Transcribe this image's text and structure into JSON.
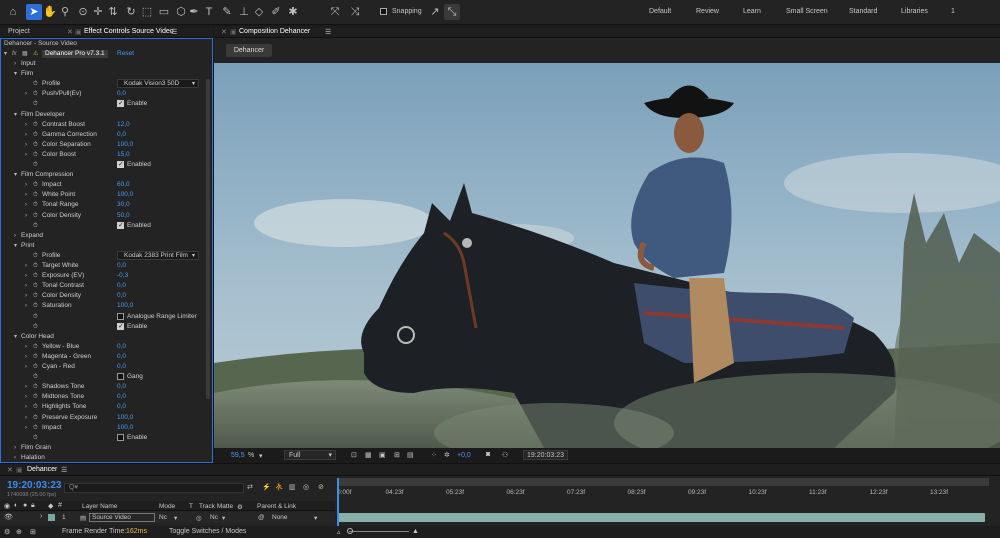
{
  "toolbar": {
    "snapping_label": "Snapping",
    "workspaces": [
      "Default",
      "Review",
      "Learn",
      "Small Screen",
      "Standard",
      "Libraries"
    ],
    "overflow": "1"
  },
  "left_panel": {
    "tabs": {
      "project": "Project",
      "effect_controls": "Effect Controls Source Video"
    },
    "layer_title": "Dehancer - Source Video",
    "effect_name": "Dehancer Pro v7.3.1",
    "reset_label": "Reset",
    "params": [
      {
        "type": "group",
        "label": "Input",
        "open": false
      },
      {
        "type": "group",
        "label": "Film",
        "open": true
      },
      {
        "type": "dropdown",
        "label": "Profile",
        "value": "Kodak Vision3 50D"
      },
      {
        "type": "value",
        "label": "Push/Pull(Ev)",
        "value": "0,0",
        "twirl": true
      },
      {
        "type": "check",
        "checked": true,
        "text": "Enable"
      },
      {
        "type": "group",
        "label": "Film Developer",
        "open": true
      },
      {
        "type": "value",
        "label": "Contrast Boost",
        "value": "12,0",
        "twirl": true
      },
      {
        "type": "value",
        "label": "Gamma Correction",
        "value": "0,0",
        "twirl": true
      },
      {
        "type": "value",
        "label": "Color Separation",
        "value": "100,0",
        "twirl": true
      },
      {
        "type": "value",
        "label": "Color Boost",
        "value": "15,0",
        "twirl": true
      },
      {
        "type": "check",
        "checked": true,
        "text": "Enabled"
      },
      {
        "type": "group",
        "label": "Film Compression",
        "open": true
      },
      {
        "type": "value",
        "label": "Impact",
        "value": "60,0",
        "twirl": true
      },
      {
        "type": "value",
        "label": "White Point",
        "value": "100,0",
        "twirl": true
      },
      {
        "type": "value",
        "label": "Tonal Range",
        "value": "30,0",
        "twirl": true
      },
      {
        "type": "value",
        "label": "Color Density",
        "value": "50,0",
        "twirl": true
      },
      {
        "type": "check",
        "checked": true,
        "text": "Enabled"
      },
      {
        "type": "group",
        "label": "Expand",
        "open": false
      },
      {
        "type": "group",
        "label": "Print",
        "open": true
      },
      {
        "type": "dropdown",
        "label": "Profile",
        "value": "Kodak 2383 Print Film"
      },
      {
        "type": "value",
        "label": "Target White",
        "value": "0,0",
        "twirl": true
      },
      {
        "type": "value",
        "label": "Exposure (EV)",
        "value": "-0,3",
        "twirl": true
      },
      {
        "type": "value",
        "label": "Tonal Contrast",
        "value": "0,0",
        "twirl": true
      },
      {
        "type": "value",
        "label": "Color Density",
        "value": "0,0",
        "twirl": true
      },
      {
        "type": "value",
        "label": "Saturation",
        "value": "100,0",
        "twirl": true
      },
      {
        "type": "check",
        "checked": false,
        "text": "Analogue Range Limiter"
      },
      {
        "type": "check",
        "checked": true,
        "text": "Enable"
      },
      {
        "type": "group",
        "label": "Color Head",
        "open": true
      },
      {
        "type": "value",
        "label": "Yellow - Blue",
        "value": "0,0",
        "twirl": true
      },
      {
        "type": "value",
        "label": "Magenta - Green",
        "value": "0,0",
        "twirl": true
      },
      {
        "type": "value",
        "label": "Cyan - Red",
        "value": "0,0",
        "twirl": true
      },
      {
        "type": "check",
        "checked": false,
        "text": "Gang"
      },
      {
        "type": "value",
        "label": "Shadows Tone",
        "value": "0,0",
        "twirl": true
      },
      {
        "type": "value",
        "label": "Midtones Tone",
        "value": "0,0",
        "twirl": true
      },
      {
        "type": "value",
        "label": "Highlights Tone",
        "value": "0,0",
        "twirl": true
      },
      {
        "type": "value",
        "label": "Preserve Exposure",
        "value": "100,0",
        "twirl": true
      },
      {
        "type": "value",
        "label": "Impact",
        "value": "100,0",
        "twirl": true
      },
      {
        "type": "check",
        "checked": false,
        "text": "Enable"
      },
      {
        "type": "group",
        "label": "Film Grain",
        "open": false
      },
      {
        "type": "group",
        "label": "Halation",
        "open": false
      }
    ]
  },
  "composition": {
    "tab": "Composition Dehancer",
    "sub_tab": "Dehancer",
    "zoom": "59,5",
    "zoom_unit": "%",
    "resolution": "Full",
    "exposure": "+0,0",
    "timecode": "19:20:03:23"
  },
  "timeline": {
    "tab": "Dehancer",
    "timecode": "19:20:03:23",
    "fps": "1740098 (25.00 fps)",
    "search_placeholder": "Q▾",
    "headers": {
      "layer_name": "Layer Name",
      "mode": "Mode",
      "t": "T",
      "track_matte": "Track Matte",
      "parent": "Parent & Link"
    },
    "layer": {
      "num": "1",
      "name": "Source Video",
      "mode": "Nc",
      "matte": "Nc",
      "parent": "None"
    },
    "ruler": [
      "0:00f",
      "04:23f",
      "05:23f",
      "06:23f",
      "07:23f",
      "08:23f",
      "09:23f",
      "10:23f",
      "11:23f",
      "12:23f",
      "13:23f"
    ],
    "render_time_label": "Frame Render Time:",
    "render_time": "162ms",
    "toggle_label": "Toggle Switches / Modes"
  },
  "colors": {
    "accent": "#2d6fd6",
    "value": "#4a9bf2",
    "timecode": "#3b8cf0",
    "track": "#87b0a8"
  }
}
